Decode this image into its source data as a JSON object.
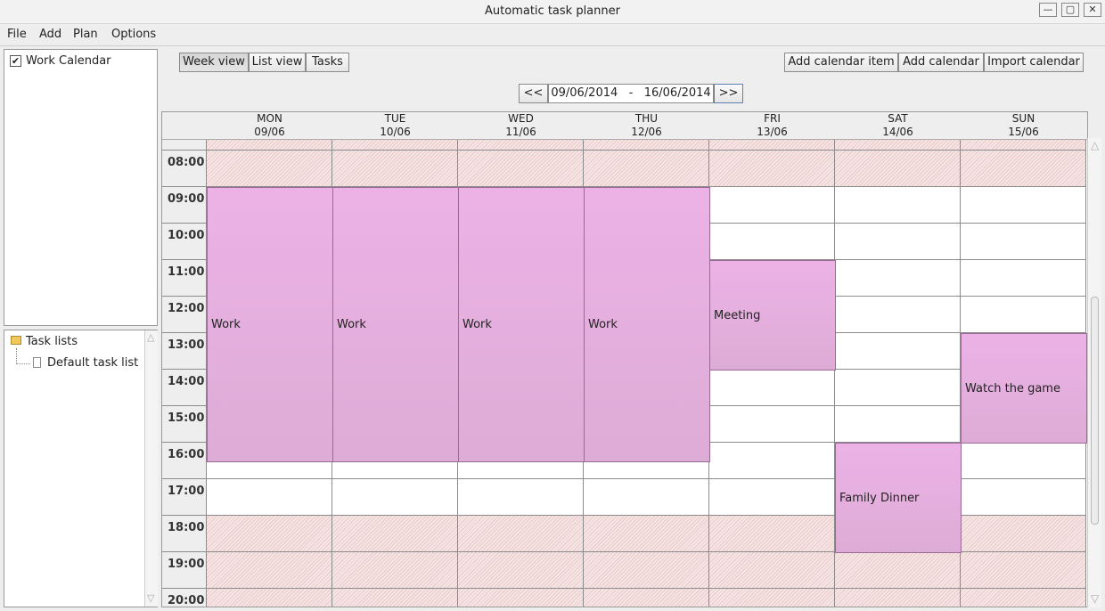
{
  "window": {
    "title": "Automatic task planner",
    "minimize": "—",
    "maximize": "▢",
    "close": "✕"
  },
  "menu": [
    "File",
    "Add",
    "Plan",
    "Options"
  ],
  "calendars": [
    {
      "label": "Work Calendar",
      "checked": true
    }
  ],
  "task_tree": {
    "root": "Task lists",
    "children": [
      "Default task list"
    ]
  },
  "view_tabs": [
    "Week view",
    "List view",
    "Tasks"
  ],
  "active_view": "Week view",
  "actions": [
    "Add calendar item",
    "Add calendar",
    "Import calendar"
  ],
  "date_nav": {
    "prev": "<<",
    "range": "09/06/2014   -   16/06/2014",
    "next": ">>"
  },
  "days": [
    {
      "name": "MON",
      "date": "09/06"
    },
    {
      "name": "TUE",
      "date": "10/06"
    },
    {
      "name": "WED",
      "date": "11/06"
    },
    {
      "name": "THU",
      "date": "12/06"
    },
    {
      "name": "FRI",
      "date": "13/06"
    },
    {
      "name": "SAT",
      "date": "14/06"
    },
    {
      "name": "SUN",
      "date": "15/06"
    }
  ],
  "times": [
    "08:00",
    "09:00",
    "10:00",
    "11:00",
    "12:00",
    "13:00",
    "14:00",
    "15:00",
    "16:00",
    "17:00",
    "18:00",
    "19:00",
    "20:00"
  ],
  "events": [
    {
      "day": 0,
      "start": "09:00",
      "end": "16:30",
      "label": "Work"
    },
    {
      "day": 1,
      "start": "09:00",
      "end": "16:30",
      "label": "Work"
    },
    {
      "day": 2,
      "start": "09:00",
      "end": "16:30",
      "label": "Work"
    },
    {
      "day": 3,
      "start": "09:00",
      "end": "16:30",
      "label": "Work"
    },
    {
      "day": 4,
      "start": "11:00",
      "end": "14:00",
      "label": "Meeting"
    },
    {
      "day": 6,
      "start": "13:00",
      "end": "16:00",
      "label": "Watch the game"
    },
    {
      "day": 5,
      "start": "16:00",
      "end": "19:00",
      "label": "Family Dinner"
    }
  ],
  "colors": {
    "event": "#e8b0e2",
    "unavailable_hatch": "#e8c8c8",
    "grid_line": "#8b8b8b"
  }
}
